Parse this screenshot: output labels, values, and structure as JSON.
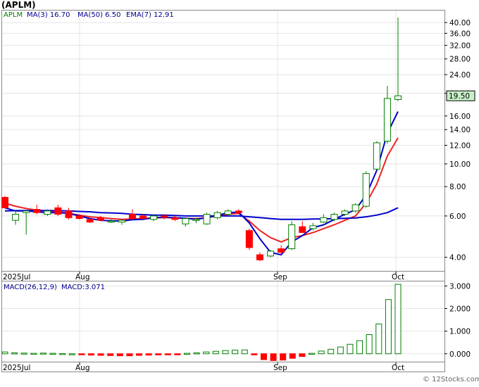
{
  "ticker_title": "(APLM)",
  "price_legend": {
    "symbol": "APLM",
    "ma3": "MA(3)   16.70",
    "ma50": "MA(50)   6.50",
    "ema7": "EMA(7)   12.91"
  },
  "macd_legend": {
    "params": "MACD(26,12,9)",
    "value": "MACD:3.071"
  },
  "watermark": "© 12Stocks.com",
  "colors": {
    "up": "#008000",
    "down": "#ff0000",
    "ma_line": "#0000cc",
    "ema_line": "#ee2222",
    "last_price_bg": "#c8f0c8"
  },
  "chart_data": [
    {
      "type": "candlestick",
      "title": "(APLM)",
      "y_scale": "log",
      "ylim": [
        3.5,
        45
      ],
      "y_ticks": [
        "4.00",
        "6.00",
        "8.00",
        "10.00",
        "12.00",
        "14.00",
        "16.00",
        "20.00",
        "24.00",
        "28.00",
        "32.00",
        "36.00",
        "40.00"
      ],
      "x_labels": [
        "2025Jul",
        "Aug",
        "Sep",
        "Oct"
      ],
      "last_price": "19.50",
      "candles": [
        {
          "o": 7.2,
          "h": 7.3,
          "l": 6.5,
          "c": 6.5
        },
        {
          "o": 5.75,
          "h": 6.3,
          "l": 5.5,
          "c": 6.1
        },
        {
          "o": 6.2,
          "h": 6.3,
          "l": 5.0,
          "c": 6.3
        },
        {
          "o": 6.4,
          "h": 6.7,
          "l": 6.1,
          "c": 6.2
        },
        {
          "o": 6.1,
          "h": 6.4,
          "l": 6.0,
          "c": 6.3
        },
        {
          "o": 6.5,
          "h": 6.7,
          "l": 6.0,
          "c": 6.1
        },
        {
          "o": 6.3,
          "h": 6.5,
          "l": 5.8,
          "c": 5.9
        },
        {
          "o": 6.0,
          "h": 6.1,
          "l": 5.8,
          "c": 5.85
        },
        {
          "o": 5.8,
          "h": 5.9,
          "l": 5.6,
          "c": 5.65
        },
        {
          "o": 5.9,
          "h": 6.0,
          "l": 5.7,
          "c": 5.75
        },
        {
          "o": 5.7,
          "h": 5.8,
          "l": 5.6,
          "c": 5.7
        },
        {
          "o": 5.65,
          "h": 5.8,
          "l": 5.5,
          "c": 5.75
        },
        {
          "o": 6.1,
          "h": 6.4,
          "l": 5.8,
          "c": 5.85
        },
        {
          "o": 6.0,
          "h": 6.1,
          "l": 5.8,
          "c": 5.85
        },
        {
          "o": 5.8,
          "h": 6.1,
          "l": 5.7,
          "c": 6.0
        },
        {
          "o": 6.0,
          "h": 6.1,
          "l": 5.8,
          "c": 5.95
        },
        {
          "o": 5.9,
          "h": 6.0,
          "l": 5.7,
          "c": 5.8
        },
        {
          "o": 5.55,
          "h": 5.9,
          "l": 5.4,
          "c": 5.85
        },
        {
          "o": 5.75,
          "h": 5.9,
          "l": 5.6,
          "c": 5.8
        },
        {
          "o": 5.55,
          "h": 6.2,
          "l": 5.5,
          "c": 6.1
        },
        {
          "o": 5.9,
          "h": 6.3,
          "l": 5.8,
          "c": 6.2
        },
        {
          "o": 6.1,
          "h": 6.4,
          "l": 6.0,
          "c": 6.3
        },
        {
          "o": 6.3,
          "h": 6.4,
          "l": 6.1,
          "c": 6.2
        },
        {
          "o": 5.2,
          "h": 5.3,
          "l": 4.3,
          "c": 4.4
        },
        {
          "o": 4.1,
          "h": 4.2,
          "l": 3.85,
          "c": 3.9
        },
        {
          "o": 4.05,
          "h": 4.3,
          "l": 4.0,
          "c": 4.25
        },
        {
          "o": 4.35,
          "h": 4.5,
          "l": 4.1,
          "c": 4.2
        },
        {
          "o": 4.35,
          "h": 5.7,
          "l": 4.3,
          "c": 5.5
        },
        {
          "o": 5.4,
          "h": 5.7,
          "l": 5.1,
          "c": 5.1
        },
        {
          "o": 5.3,
          "h": 5.6,
          "l": 5.2,
          "c": 5.45
        },
        {
          "o": 5.65,
          "h": 6.1,
          "l": 5.6,
          "c": 5.9
        },
        {
          "o": 5.8,
          "h": 6.2,
          "l": 5.7,
          "c": 6.1
        },
        {
          "o": 6.1,
          "h": 6.4,
          "l": 6.0,
          "c": 6.3
        },
        {
          "o": 6.3,
          "h": 6.8,
          "l": 6.2,
          "c": 6.7
        },
        {
          "o": 6.6,
          "h": 9.3,
          "l": 6.5,
          "c": 9.1
        },
        {
          "o": 9.5,
          "h": 12.5,
          "l": 9.4,
          "c": 12.3
        },
        {
          "o": 12.5,
          "h": 21.5,
          "l": 12.2,
          "c": 19.0
        },
        {
          "o": 18.8,
          "h": 42.0,
          "l": 18.5,
          "c": 19.5
        }
      ],
      "ma3": [
        6.5,
        6.3,
        6.3,
        6.25,
        6.2,
        6.2,
        6.15,
        6.0,
        5.85,
        5.75,
        5.72,
        5.7,
        5.78,
        5.8,
        5.9,
        5.93,
        5.9,
        5.86,
        5.8,
        5.9,
        6.03,
        6.2,
        6.23,
        5.6,
        4.8,
        4.2,
        4.1,
        4.65,
        4.95,
        5.35,
        5.5,
        5.8,
        6.1,
        6.37,
        7.37,
        9.37,
        13.5,
        16.7
      ],
      "ma50": [
        6.3,
        6.32,
        6.33,
        6.33,
        6.33,
        6.32,
        6.3,
        6.27,
        6.25,
        6.2,
        6.18,
        6.15,
        6.1,
        6.08,
        6.05,
        6.05,
        6.03,
        6.0,
        6.0,
        6.0,
        6.0,
        6.0,
        6.0,
        5.95,
        5.9,
        5.85,
        5.8,
        5.8,
        5.8,
        5.82,
        5.83,
        5.84,
        5.86,
        5.88,
        5.95,
        6.05,
        6.2,
        6.5
      ],
      "ema7": [
        6.8,
        6.6,
        6.45,
        6.35,
        6.3,
        6.25,
        6.15,
        6.05,
        5.95,
        5.9,
        5.85,
        5.8,
        5.83,
        5.85,
        5.88,
        5.9,
        5.88,
        5.86,
        5.85,
        5.9,
        6.0,
        6.1,
        6.15,
        5.7,
        5.2,
        4.85,
        4.65,
        4.85,
        4.95,
        5.1,
        5.3,
        5.5,
        5.75,
        6.0,
        6.8,
        8.2,
        10.8,
        12.91
      ]
    },
    {
      "type": "bar",
      "title": "MACD(26,12,9)",
      "ylim": [
        -0.35,
        3.2
      ],
      "y_ticks": [
        "0.000",
        "1.000",
        "2.000",
        "3.000"
      ],
      "x_labels": [
        "2025Jul",
        "Aug",
        "Sep",
        "Oct"
      ],
      "values": [
        0.08,
        0.04,
        0.03,
        0.02,
        0.03,
        0.02,
        0.01,
        0.0,
        -0.04,
        -0.06,
        -0.07,
        -0.08,
        -0.09,
        -0.09,
        -0.07,
        -0.06,
        -0.05,
        -0.04,
        -0.02,
        0.02,
        0.04,
        0.08,
        0.11,
        0.14,
        0.16,
        0.17,
        -0.05,
        -0.26,
        -0.3,
        -0.28,
        -0.2,
        -0.12,
        0.02,
        0.12,
        0.2,
        0.3,
        0.42,
        0.58,
        0.85,
        1.32,
        2.4,
        3.071
      ]
    }
  ]
}
